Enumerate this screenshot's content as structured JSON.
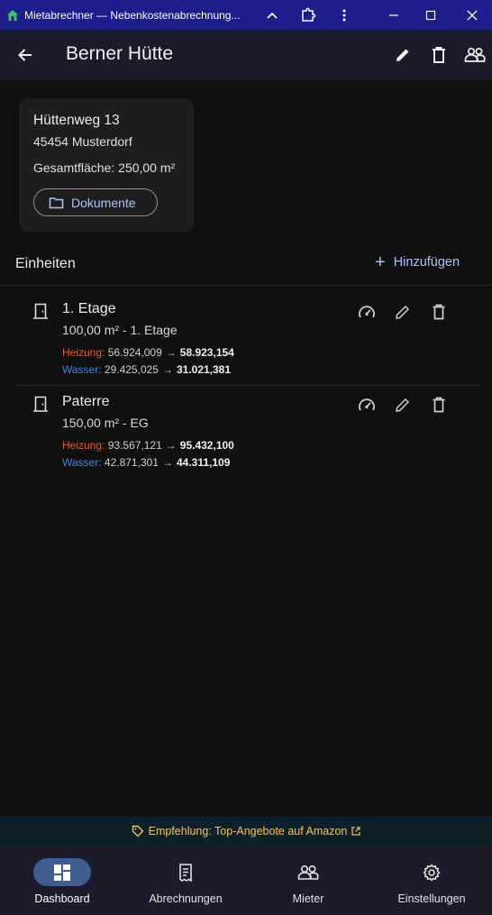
{
  "window": {
    "title": "Mietabrechner — Nebenkostenabrechnung..."
  },
  "appbar": {
    "title": "Berner Hütte"
  },
  "property": {
    "street": "Hüttenweg 13",
    "city": "45454 Musterdorf",
    "area": "Gesamtfläche: 250,00 m²",
    "documents_label": "Dokumente"
  },
  "units_section": {
    "title": "Einheiten",
    "add_label": "Hinzufügen",
    "units": [
      {
        "name": "1. Etage",
        "desc": "100,00 m² - 1. Etage",
        "heating_label": "Heizung:",
        "heating_from": "56.924,009",
        "heating_to": "58.923,154",
        "water_label": "Wasser:",
        "water_from": "29.425,025",
        "water_to": "31.021,381"
      },
      {
        "name": "Paterre",
        "desc": "150,00 m² - EG",
        "heating_label": "Heizung:",
        "heating_from": "93.567,121",
        "heating_to": "95.432,100",
        "water_label": "Wasser:",
        "water_from": "42.871,301",
        "water_to": "44.311,109"
      }
    ]
  },
  "banner": {
    "text": "Empfehlung: Top-Angebote auf Amazon"
  },
  "bottom_nav": {
    "items": [
      {
        "label": "Dashboard",
        "icon": "dashboard-icon",
        "active": true
      },
      {
        "label": "Abrechnungen",
        "icon": "receipt-icon",
        "active": false
      },
      {
        "label": "Mieter",
        "icon": "people-icon",
        "active": false
      },
      {
        "label": "Einstellungen",
        "icon": "gear-icon",
        "active": false
      }
    ]
  },
  "colors": {
    "window_bar": "#1d1d8c",
    "appbar": "#1c1b2b",
    "accent": "#a9c3ff",
    "heating": "#e65a2a",
    "water": "#3d86e0",
    "banner_text": "#f2c451",
    "nav_active": "#3f5d91"
  }
}
